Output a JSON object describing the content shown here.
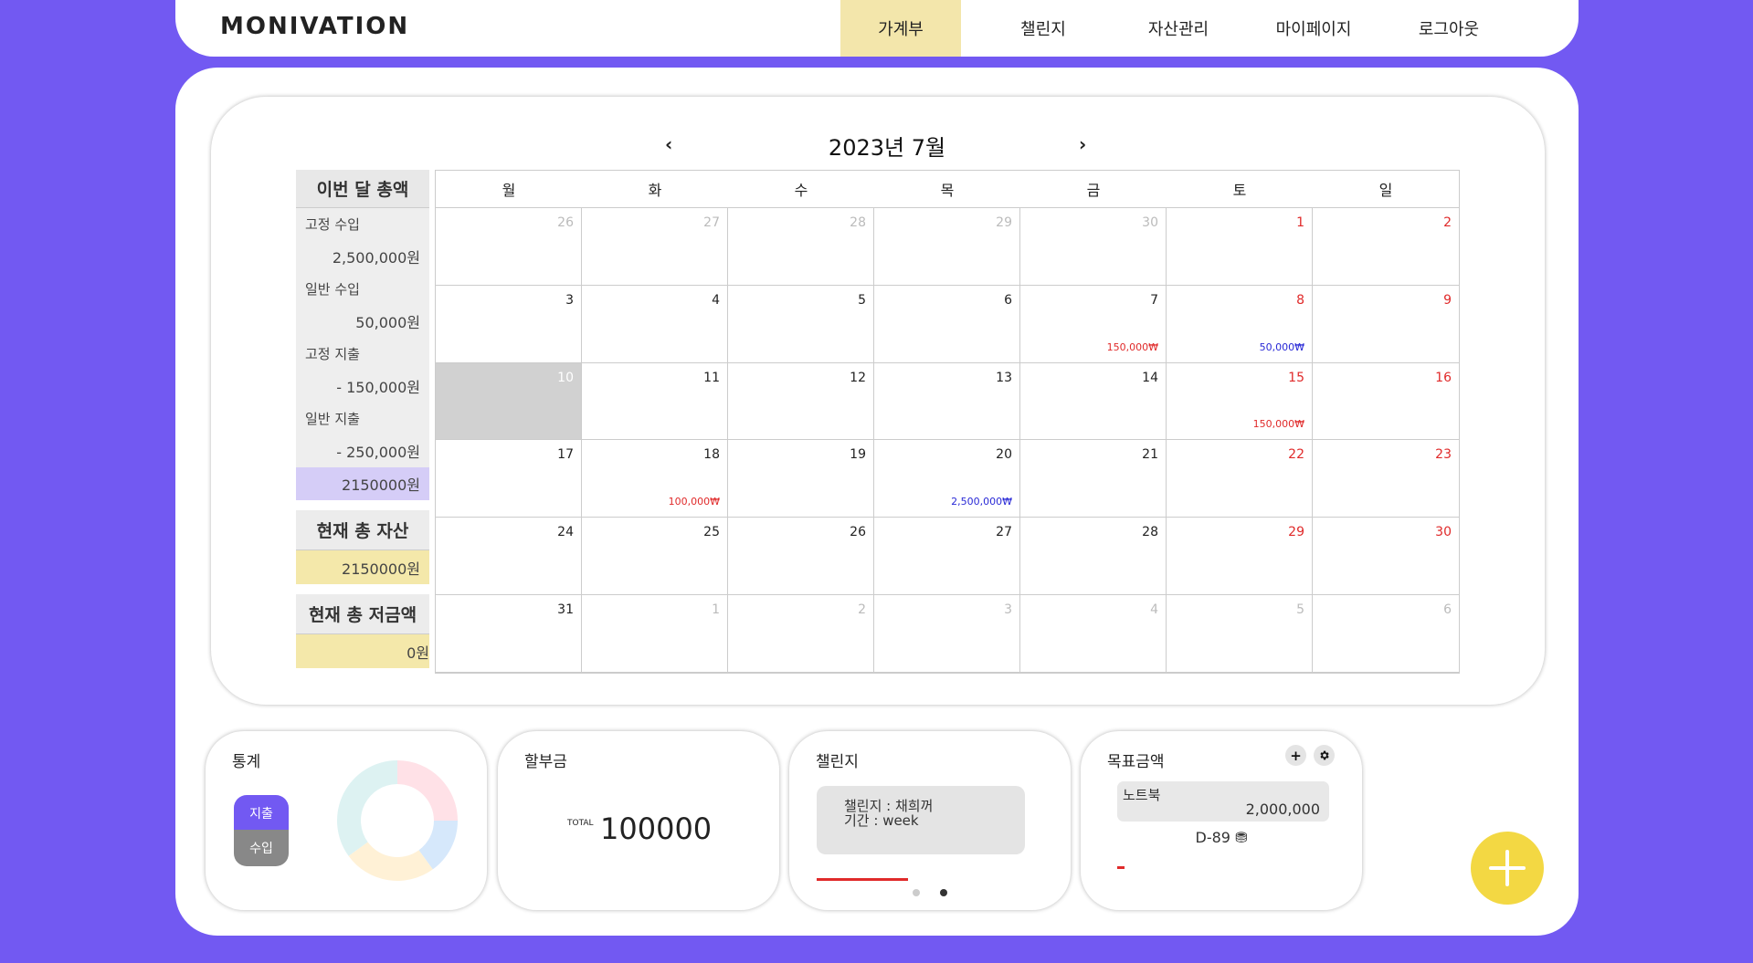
{
  "header": {
    "logo": "MONIVATION",
    "nav": [
      "가계부",
      "챌린지",
      "자산관리",
      "마이페이지",
      "로그아웃"
    ],
    "active_index": 0
  },
  "calendar": {
    "prev": "‹",
    "next": "›",
    "title": "2023년 7월",
    "weekdays": [
      "월",
      "화",
      "수",
      "목",
      "금",
      "토",
      "일"
    ],
    "weeks": [
      [
        {
          "d": "26",
          "o": true
        },
        {
          "d": "27",
          "o": true
        },
        {
          "d": "28",
          "o": true
        },
        {
          "d": "29",
          "o": true
        },
        {
          "d": "30",
          "o": true
        },
        {
          "d": "1",
          "w": true
        },
        {
          "d": "2",
          "w": true
        }
      ],
      [
        {
          "d": "3"
        },
        {
          "d": "4"
        },
        {
          "d": "5"
        },
        {
          "d": "6"
        },
        {
          "d": "7",
          "amt": "150,000₩",
          "t": "exp"
        },
        {
          "d": "8",
          "w": true,
          "amt": "50,000₩",
          "t": "inc"
        },
        {
          "d": "9",
          "w": true
        }
      ],
      [
        {
          "d": "10",
          "today": true
        },
        {
          "d": "11"
        },
        {
          "d": "12"
        },
        {
          "d": "13"
        },
        {
          "d": "14"
        },
        {
          "d": "15",
          "w": true,
          "amt": "150,000₩",
          "t": "exp"
        },
        {
          "d": "16",
          "w": true
        }
      ],
      [
        {
          "d": "17"
        },
        {
          "d": "18",
          "amt": "100,000₩",
          "t": "exp"
        },
        {
          "d": "19"
        },
        {
          "d": "20",
          "amt": "2,500,000₩",
          "t": "inc"
        },
        {
          "d": "21"
        },
        {
          "d": "22",
          "w": true
        },
        {
          "d": "23",
          "w": true
        }
      ],
      [
        {
          "d": "24"
        },
        {
          "d": "25"
        },
        {
          "d": "26"
        },
        {
          "d": "27"
        },
        {
          "d": "28"
        },
        {
          "d": "29",
          "w": true
        },
        {
          "d": "30",
          "w": true
        }
      ],
      [
        {
          "d": "31"
        },
        {
          "d": "1",
          "o": true
        },
        {
          "d": "2",
          "o": true
        },
        {
          "d": "3",
          "o": true
        },
        {
          "d": "4",
          "o": true
        },
        {
          "d": "5",
          "o": true
        },
        {
          "d": "6",
          "o": true
        }
      ]
    ]
  },
  "summary": {
    "title": "이번 달 총액",
    "fixed_income_label": "고정 수입",
    "fixed_income": "2,500,000원",
    "general_income_label": "일반 수입",
    "general_income": "50,000원",
    "fixed_expense_label": "고정 지출",
    "fixed_expense": "- 150,000원",
    "general_expense_label": "일반 지출",
    "general_expense": "- 250,000원",
    "total": "2150000원",
    "asset_title": "현재 총 자산",
    "asset_value": "2150000원",
    "savings_title": "현재 총 저금액",
    "savings_value": "0원"
  },
  "stats": {
    "title": "통계",
    "expense_tab": "지출",
    "income_tab": "수입",
    "donut_colors": [
      "#ffe1e7",
      "#d6e8fb",
      "#fff1d6",
      "#ddf2f2"
    ]
  },
  "installment": {
    "title": "할부금",
    "total_label": "TOTAL",
    "total_value": "100000"
  },
  "challenge": {
    "title": "챌린지",
    "line1": "챌린지 : 채희꺼",
    "line2": "기간 : week"
  },
  "goal": {
    "title": "목표금액",
    "add_icon": "+",
    "item_name": "노트북",
    "item_amount": "2,000,000",
    "dday": "D-89",
    "coin_icon": "⛃"
  },
  "colors": {
    "accent": "#7259f2",
    "yellow": "#f3e6ab",
    "fab": "#f3d843",
    "expense": "#e02a2a",
    "income": "#2929d6"
  }
}
